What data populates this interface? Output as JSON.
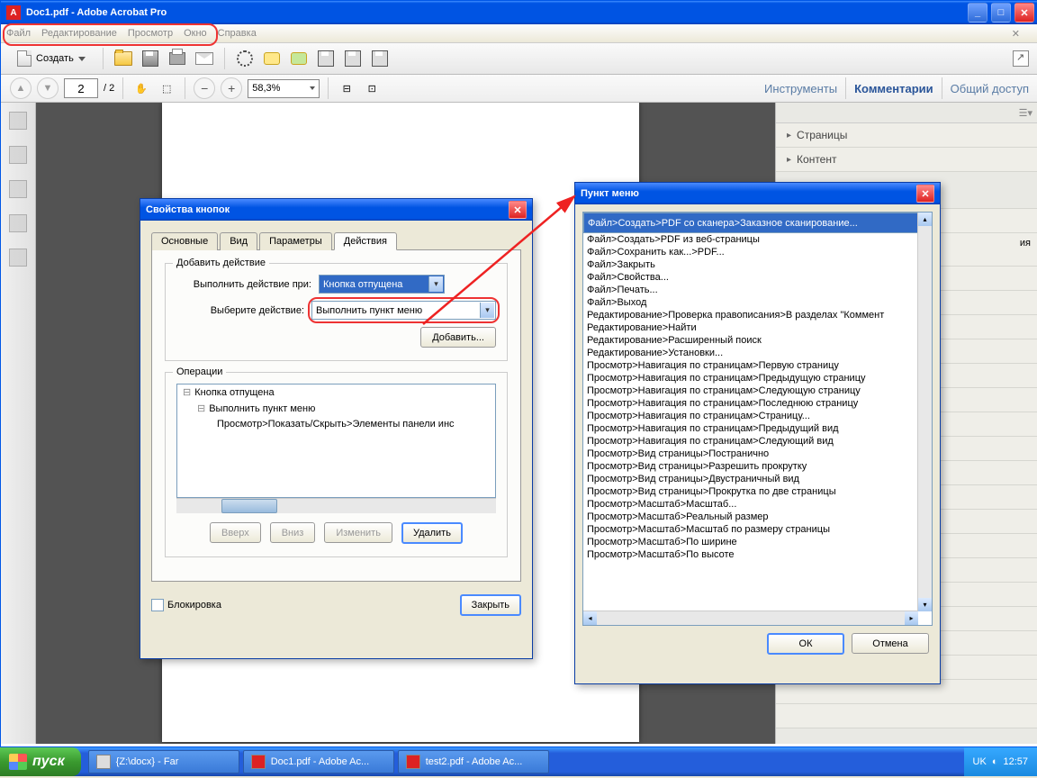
{
  "title": "Doc1.pdf - Adobe Acrobat Pro",
  "menubar": [
    "Файл",
    "Редактирование",
    "Просмотр",
    "Окно",
    "Справка"
  ],
  "toolbar": {
    "create": "Создать"
  },
  "nav": {
    "page": "2",
    "total": "/  2",
    "zoom": "58,3%"
  },
  "sidelinks": {
    "tools": "Инструменты",
    "comments": "Комментарии",
    "share": "Общий доступ"
  },
  "rightpanel": {
    "pages": "Страницы",
    "content": "Контент",
    "obscured": "ия"
  },
  "dlg1": {
    "title": "Свойства кнопок",
    "tabs": [
      "Основные",
      "Вид",
      "Параметры",
      "Действия"
    ],
    "fs1": "Добавить действие",
    "lbl_trigger": "Выполнить действие при:",
    "val_trigger": "Кнопка отпущена",
    "lbl_action": "Выберите действие:",
    "val_action": "Выполнить пункт меню",
    "add": "Добавить...",
    "fs2": "Операции",
    "op_root": "Кнопка отпущена",
    "op_child": "Выполнить пункт меню",
    "op_leaf": "Просмотр>Показать/Скрыть>Элементы панели инс",
    "up": "Вверх",
    "down": "Вниз",
    "edit": "Изменить",
    "del": "Удалить",
    "lock": "Блокировка",
    "close": "Закрыть"
  },
  "dlg2": {
    "title": "Пункт меню",
    "items": [
      "Файл>Создать>PDF со сканера>Заказное сканирование...",
      "Файл>Создать>PDF из веб-страницы",
      "Файл>Сохранить как...>PDF...",
      "Файл>Закрыть",
      "Файл>Свойства...",
      "Файл>Печать...",
      "Файл>Выход",
      "Редактирование>Проверка правописания>В разделах \"Коммент",
      "Редактирование>Найти",
      "Редактирование>Расширенный поиск",
      "Редактирование>Установки...",
      "Просмотр>Навигация по страницам>Первую страницу",
      "Просмотр>Навигация по страницам>Предыдущую страницу",
      "Просмотр>Навигация по страницам>Следующую страницу",
      "Просмотр>Навигация по страницам>Последнюю страницу",
      "Просмотр>Навигация по страницам>Страницу...",
      "Просмотр>Навигация по страницам>Предыдущий вид",
      "Просмотр>Навигация по страницам>Следующий вид",
      "Просмотр>Вид страницы>Постранично",
      "Просмотр>Вид страницы>Разрешить прокрутку",
      "Просмотр>Вид страницы>Двустраничный вид",
      "Просмотр>Вид страницы>Прокрутка по две страницы",
      "Просмотр>Масштаб>Масштаб...",
      "Просмотр>Масштаб>Реальный размер",
      "Просмотр>Масштаб>Масштаб по размеру страницы",
      "Просмотр>Масштаб>По ширине",
      "Просмотр>Масштаб>По высоте"
    ],
    "ok": "ОК",
    "cancel": "Отмена"
  },
  "taskbar": {
    "start": "пуск",
    "t1": "{Z:\\docx} - Far",
    "t2": "Doc1.pdf - Adobe Ac...",
    "t3": "test2.pdf - Adobe Ac...",
    "lang": "UK",
    "time": "12:57"
  }
}
